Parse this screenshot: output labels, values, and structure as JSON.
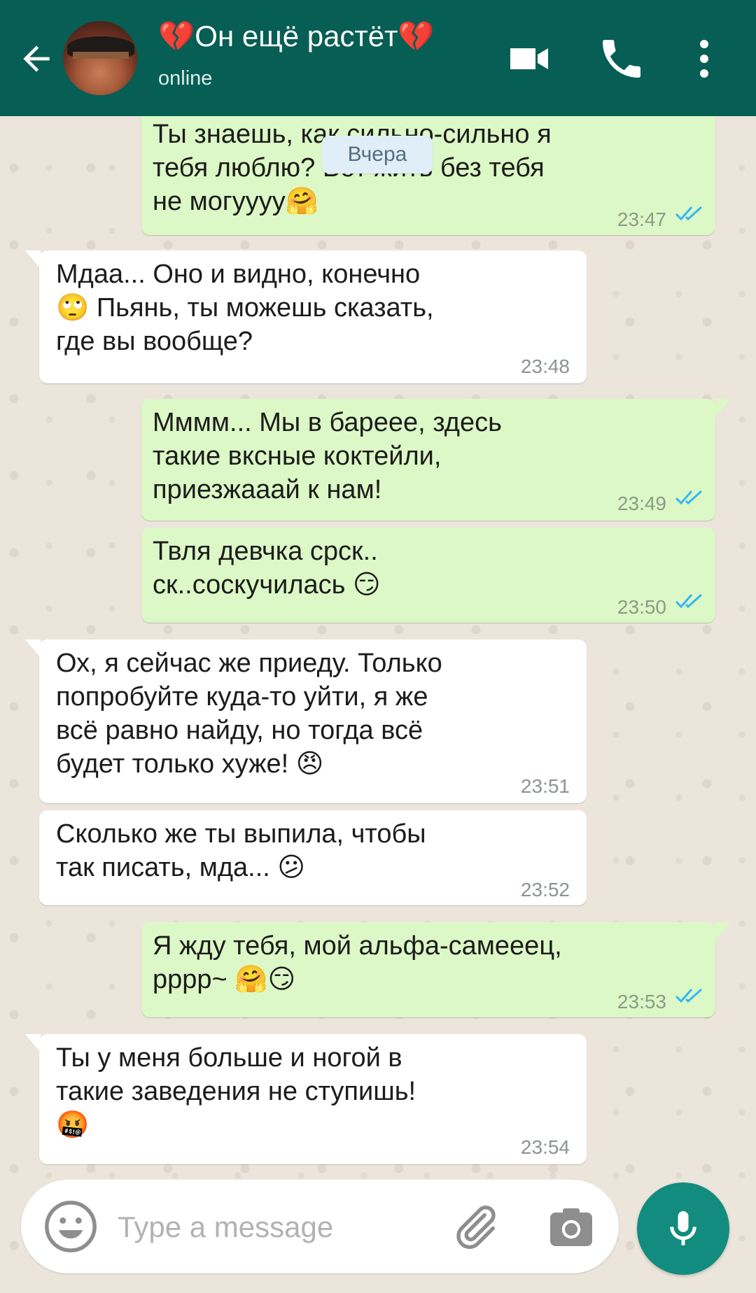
{
  "header": {
    "title": "💔Он ещё растёт💔",
    "status": "online",
    "colors": {
      "bar": "#075e54"
    }
  },
  "date_chip": "Вчера",
  "messages": [
    {
      "dir": "out",
      "text": "Ты знаешь, как сильно-сильно я\nтебя люблю? Вот жить без тебя\nне могуууу🤗",
      "time": "23:47",
      "read": true
    },
    {
      "dir": "in",
      "text": "Мдаа... Оно и видно, конечно\n🙄 Пьянь, ты можешь сказать,\nгде вы вообще?",
      "time": "23:48"
    },
    {
      "dir": "out",
      "text": "Мммм... Мы в бареее, здесь\nтакие вксные коктейли,\nприезжааай к нам!",
      "time": "23:49",
      "read": true
    },
    {
      "dir": "out",
      "text": "Твля девчка срск..\nск..соскучилась 😏",
      "time": "23:50",
      "read": true
    },
    {
      "dir": "in",
      "text": "Ох, я сейчас же приеду. Только\nпопробуйте куда-то уйти, я же\nвсё равно найду, но тогда всё\nбудет только хуже! 😠",
      "time": "23:51"
    },
    {
      "dir": "in",
      "text": "Сколько же ты выпила, чтобы\nтак писать, мда... 😕",
      "time": "23:52"
    },
    {
      "dir": "out",
      "text": "Я жду тебя, мой альфа-самееец,\nрррр~ 🤗😏",
      "time": "23:53",
      "read": true
    },
    {
      "dir": "in",
      "text": "Ты у меня больше и ногой в\nтакие заведения не ступишь!\n🤬",
      "time": "23:54"
    }
  ],
  "input": {
    "placeholder": "Type a message"
  },
  "icons": [
    "back-arrow-icon",
    "video-call-icon",
    "phone-icon",
    "more-vert-icon",
    "emoji-icon",
    "attach-icon",
    "camera-icon",
    "mic-icon"
  ],
  "colors": {
    "outgoing_bubble": "#dcf8c6",
    "incoming_bubble": "#ffffff",
    "read_ticks": "#34b7f1",
    "fab": "#128c7e"
  }
}
